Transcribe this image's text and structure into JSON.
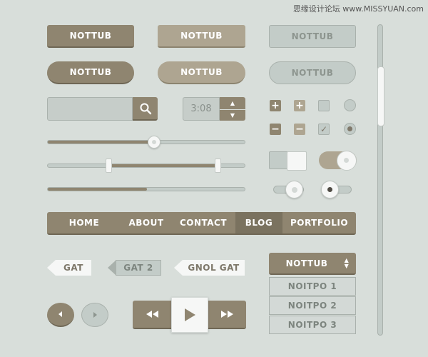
{
  "watermark": "思缘设计论坛 www.MISSYUAN.com",
  "buttons": {
    "label": "NOTTUB"
  },
  "time": {
    "value": "3:08"
  },
  "sliders": {
    "single_value": 0.54,
    "range_low": 0.31,
    "range_high": 0.86,
    "progress_value": 0.5
  },
  "nav": {
    "items": [
      {
        "label": "HOME"
      },
      {
        "label": "ABOUT"
      },
      {
        "label": "CONTACT"
      },
      {
        "label": "BLOG"
      },
      {
        "label": "PORTFOLIO"
      }
    ],
    "active_index": 3
  },
  "tags": [
    {
      "label": "GAT"
    },
    {
      "label": "GAT 2"
    },
    {
      "label": "GNOL GAT"
    }
  ],
  "dropdown": {
    "label": "NOTTUB",
    "options": [
      "NOITPO 1",
      "NOITPO 2",
      "NOITPO 3"
    ]
  },
  "icons": {
    "search": "search-icon",
    "plus": "+",
    "minus": "−",
    "check": "✓"
  },
  "colors": {
    "primary": "#8f8570",
    "secondary": "#aea591",
    "surface": "#c3ccc8",
    "background": "#d8deda"
  }
}
